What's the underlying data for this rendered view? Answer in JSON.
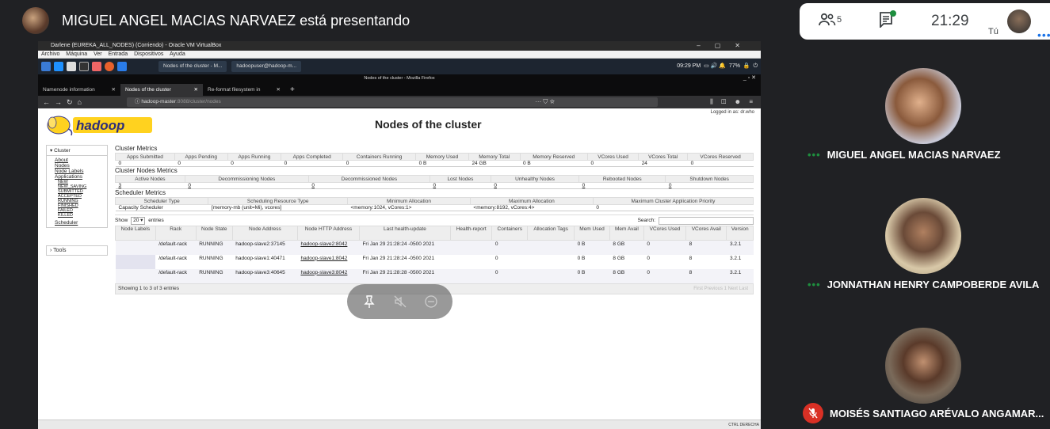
{
  "presenter": {
    "text": "MIGUEL ANGEL MACIAS NARVAEZ está presentando"
  },
  "meet": {
    "people_count": "5",
    "time": "21:29",
    "self_label": "Tú"
  },
  "vbox": {
    "title": "Darlene (EUREKA_ALL_NODES) (Corriendo) - Oracle VM VirtualBox",
    "menu": [
      "Archivo",
      "Máquina",
      "Ver",
      "Entrada",
      "Dispositivos",
      "Ayuda"
    ],
    "status_right": "CTRL DERECHA"
  },
  "os": {
    "window1": "Nodes of the cluster - M...",
    "window2": "hadoopuser@hadoop-m...",
    "tray": "09:29 PM",
    "battery": "77%"
  },
  "firefox": {
    "window_title": "Nodes of the cluster - Mozilla Firefox",
    "tabs": [
      {
        "label": "Namenode information"
      },
      {
        "label": "Nodes of the cluster"
      },
      {
        "label": "Re-format filesystem in"
      }
    ],
    "url_host": "hadoop-master",
    "url_rest": ":8088/cluster/nodes"
  },
  "hadoop": {
    "title": "Nodes of the cluster",
    "logged_in": "Logged in as: dr.who",
    "sidebar": {
      "cluster": "Cluster",
      "links": [
        "About",
        "Nodes",
        "Node Labels",
        "Applications"
      ],
      "app_states": [
        "NEW",
        "NEW_SAVING",
        "SUBMITTED",
        "ACCEPTED",
        "RUNNING",
        "FINISHED",
        "FAILED",
        "KILLED"
      ],
      "scheduler": "Scheduler",
      "tools": "Tools"
    },
    "cluster_metrics": {
      "title": "Cluster Metrics",
      "headers": [
        "Apps Submitted",
        "Apps Pending",
        "Apps Running",
        "Apps Completed",
        "Containers Running",
        "Memory Used",
        "Memory Total",
        "Memory Reserved",
        "VCores Used",
        "VCores Total",
        "VCores Reserved"
      ],
      "values": [
        "0",
        "0",
        "0",
        "0",
        "0",
        "0 B",
        "24 GB",
        "0 B",
        "0",
        "24",
        "0"
      ]
    },
    "node_metrics": {
      "title": "Cluster Nodes Metrics",
      "headers": [
        "Active Nodes",
        "Decommissioning Nodes",
        "Decommissioned Nodes",
        "Lost Nodes",
        "Unhealthy Nodes",
        "Rebooted Nodes",
        "Shutdown Nodes"
      ],
      "values": [
        "3",
        "0",
        "0",
        "0",
        "0",
        "0",
        "0"
      ]
    },
    "scheduler_metrics": {
      "title": "Scheduler Metrics",
      "headers": [
        "Scheduler Type",
        "Scheduling Resource Type",
        "Minimum Allocation",
        "Maximum Allocation",
        "Maximum Cluster Application Priority"
      ],
      "values": [
        "Capacity Scheduler",
        "[memory-mb (unit=Mi), vcores]",
        "<memory:1024, vCores:1>",
        "<memory:8192, vCores:4>",
        "0"
      ]
    },
    "table": {
      "show": "Show",
      "page_size": "20",
      "entries": "entries",
      "search_label": "Search:",
      "headers": [
        "Node Labels",
        "Rack",
        "Node State",
        "Node Address",
        "Node HTTP Address",
        "Last health-update",
        "Health-report",
        "Containers",
        "Allocation Tags",
        "Mem Used",
        "Mem Avail",
        "VCores Used",
        "VCores Avail",
        "Version"
      ],
      "rows": [
        {
          "labels": "",
          "rack": "/default-rack",
          "state": "RUNNING",
          "address": "hadoop-slave2:37145",
          "http": "hadoop-slave2:8042",
          "health_update": "Fri Jan 29 21:28:24 -0500 2021",
          "report": "",
          "containers": "0",
          "tags": "",
          "mem_used": "0 B",
          "mem_avail": "8 GB",
          "vc_used": "0",
          "vc_avail": "8",
          "version": "3.2.1"
        },
        {
          "labels": "",
          "rack": "/default-rack",
          "state": "RUNNING",
          "address": "hadoop-slave1:40471",
          "http": "hadoop-slave1:8042",
          "health_update": "Fri Jan 29 21:28:24 -0500 2021",
          "report": "",
          "containers": "0",
          "tags": "",
          "mem_used": "0 B",
          "mem_avail": "8 GB",
          "vc_used": "0",
          "vc_avail": "8",
          "version": "3.2.1"
        },
        {
          "labels": "",
          "rack": "/default-rack",
          "state": "RUNNING",
          "address": "hadoop-slave3:40645",
          "http": "hadoop-slave3:8042",
          "health_update": "Fri Jan 29 21:28:28 -0500 2021",
          "report": "",
          "containers": "0",
          "tags": "",
          "mem_used": "0 B",
          "mem_avail": "8 GB",
          "vc_used": "0",
          "vc_avail": "8",
          "version": "3.2.1"
        }
      ],
      "showing": "Showing 1 to 3 of 3 entries",
      "pager": [
        "First",
        "Previous",
        "1",
        "Next",
        "Last"
      ]
    }
  },
  "participants": [
    {
      "name": "MIGUEL ANGEL MACIAS NARVAEZ"
    },
    {
      "name": "JONNATHAN HENRY CAMPOBERDE AVILA"
    },
    {
      "name": "MOISÉS SANTIAGO ARÉVALO ANGAMAR..."
    }
  ]
}
